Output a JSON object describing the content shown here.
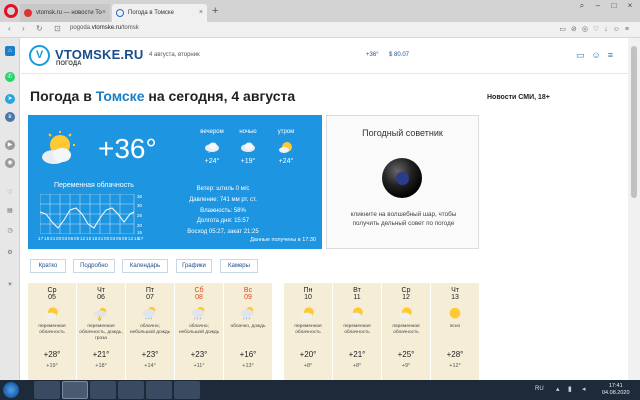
{
  "browser": {
    "tabs": [
      {
        "label": "vtomsk.ru — новости То"
      },
      {
        "label": "Погода в Томске"
      }
    ],
    "new_tab": "+",
    "url_prefix": "pogoda.",
    "url_domain": "vtomske.ru",
    "url_suffix": "/tomsk"
  },
  "site": {
    "logo_letter": "V",
    "logo_text": "VTOMSKE.RU",
    "logo_sub": "ПОГОДА",
    "date": "4 августа, вторник",
    "temp": "+36°",
    "usd": "$ 80.07"
  },
  "page": {
    "title_prefix": "Погода в ",
    "title_city": "Томске",
    "title_suffix": " на сегодня, 4 августа",
    "news_heading": "Новости СМИ, 18+"
  },
  "current": {
    "temp": "+36°",
    "condition": "Переменная облачность",
    "hours": [
      "17",
      "18",
      "21",
      "00",
      "03",
      "06",
      "09",
      "12",
      "15",
      "18",
      "21",
      "00",
      "03",
      "06",
      "09",
      "12",
      "15",
      "17"
    ],
    "periods": [
      {
        "label": "вечером",
        "temp": "+24°"
      },
      {
        "label": "ночью",
        "temp": "+19°"
      },
      {
        "label": "утром",
        "temp": "+24°"
      }
    ],
    "wind": "Ветер: штиль 0 м/с",
    "pressure": "Давление: 741 мм рт. ст.",
    "humidity": "Влажность: 58%",
    "daylength": "Долгота дня: 15:57",
    "sun": "Восход 05:27, закат 21:25",
    "updated": "Данные получены в 17:30"
  },
  "advisor": {
    "heading": "Погодный советник",
    "text": "кликните на волшебный шар, чтобы получить дельный совет по погоде"
  },
  "view_buttons": [
    "Кратко",
    "Подробно",
    "Календарь",
    "Графики",
    "Камеры"
  ],
  "forecast": [
    {
      "dow": "Ср",
      "day": "05",
      "desc": "переменная облачность",
      "hi": "+28°",
      "lo": "+19°",
      "weekend": false,
      "icon": "partly-cloudy-icon"
    },
    {
      "dow": "Чт",
      "day": "06",
      "desc": "переменная облачность, дождь, гроза",
      "hi": "+21°",
      "lo": "+18°",
      "weekend": false,
      "icon": "thunderstorm-icon"
    },
    {
      "dow": "Пт",
      "day": "07",
      "desc": "облачно; небольшой дождь",
      "hi": "+23°",
      "lo": "+14°",
      "weekend": false,
      "icon": "cloud-rain-icon"
    },
    {
      "dow": "Сб",
      "day": "08",
      "desc": "облачно; небольшой дождь",
      "hi": "+23°",
      "lo": "+11°",
      "weekend": true,
      "icon": "cloud-rain-icon"
    },
    {
      "dow": "Вс",
      "day": "09",
      "desc": "облачно, дождь",
      "hi": "+16°",
      "lo": "+13°",
      "weekend": true,
      "icon": "cloud-rain-icon"
    },
    {
      "dow": "Пн",
      "day": "10",
      "desc": "переменная облачность",
      "hi": "+20°",
      "lo": "+8°",
      "weekend": false,
      "icon": "partly-cloudy-icon"
    },
    {
      "dow": "Вт",
      "day": "11",
      "desc": "переменная облачность",
      "hi": "+21°",
      "lo": "+8°",
      "weekend": false,
      "icon": "partly-cloudy-icon"
    },
    {
      "dow": "Ср",
      "day": "12",
      "desc": "переменная облачность",
      "hi": "+25°",
      "lo": "+9°",
      "weekend": false,
      "icon": "partly-cloudy-icon"
    },
    {
      "dow": "Чт",
      "day": "13",
      "desc": "ясно",
      "hi": "+28°",
      "lo": "+12°",
      "weekend": false,
      "icon": "sun-icon"
    }
  ],
  "taskbar": {
    "lang": "RU",
    "time": "17:41",
    "date": "04.08.2020"
  },
  "colors": {
    "panel_blue": "#1e95e0",
    "brand": "#1a4d8c",
    "accent": "#1a7ec8",
    "card_bg": "#f6edd7",
    "weekend": "#e0461e"
  }
}
